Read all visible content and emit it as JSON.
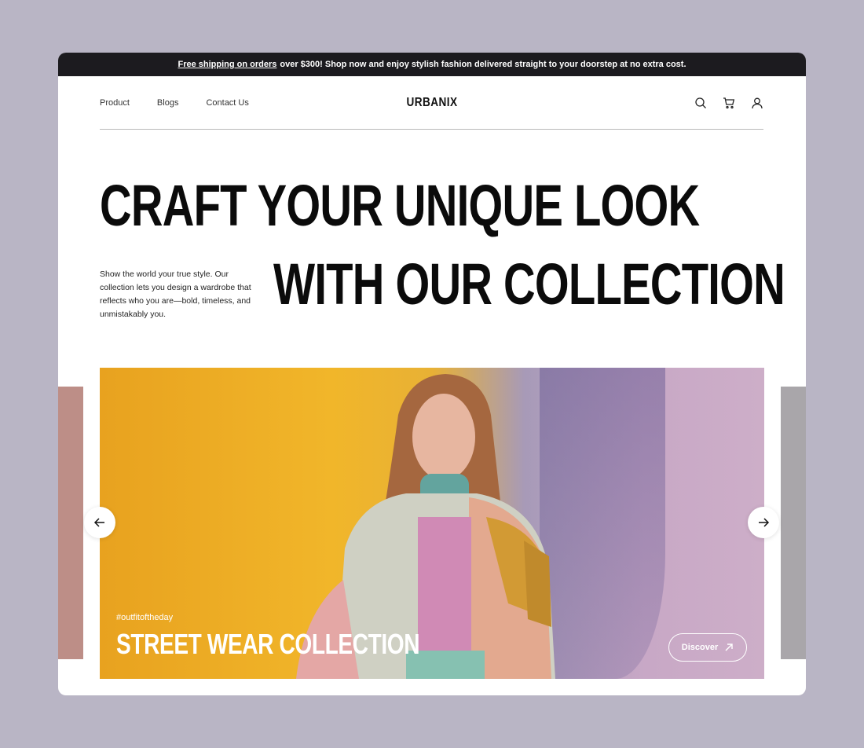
{
  "promo": {
    "link_text": "Free shipping on orders",
    "rest_text": "over $300! Shop now and enjoy stylish fashion delivered straight to your doorstep at no extra cost."
  },
  "nav": {
    "links": [
      "Product",
      "Blogs",
      "Contact Us"
    ],
    "brand": "URBANIX",
    "icons": [
      "search-icon",
      "cart-icon",
      "user-icon"
    ]
  },
  "hero_heading": {
    "line1": "CRAFT YOUR UNIQUE LOOK",
    "line2": "WITH OUR COLLECTION"
  },
  "intro_text": "Show the world your true style. Our collection lets you design a wardrobe that reflects who you are—bold, timeless, and unmistakably you.",
  "slide": {
    "tag": "#outfitoftheday",
    "title": "STREET WEAR COLLECTION",
    "button_label": "Discover"
  },
  "colors": {
    "page_bg": "#b9b5c5",
    "promo_bg": "#1c1b1f",
    "accent_yellow": "#f1b62a",
    "accent_lilac": "#c8a8c6"
  }
}
